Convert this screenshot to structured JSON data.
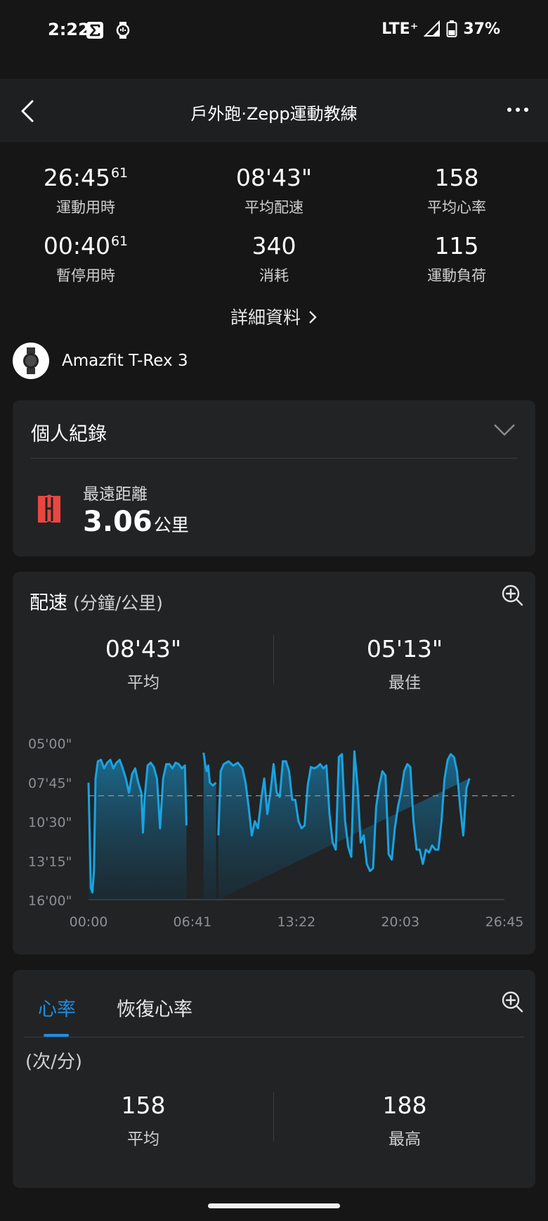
{
  "status_bar": {
    "time": "2:22",
    "network": "LTE⁺",
    "battery": "37%"
  },
  "header": {
    "title": "戶外跑·Zepp運動教練"
  },
  "summary": {
    "stats": [
      {
        "value": "26:45",
        "sup": "61",
        "label": "運動用時"
      },
      {
        "value": "08'43\"",
        "sup": "",
        "label": "平均配速"
      },
      {
        "value": "158",
        "sup": "",
        "label": "平均心率"
      },
      {
        "value": "00:40",
        "sup": "61",
        "label": "暫停用時"
      },
      {
        "value": "340",
        "sup": "",
        "label": "消耗"
      },
      {
        "value": "115",
        "sup": "",
        "label": "運動負荷"
      }
    ],
    "details_label": "詳細資料"
  },
  "device": {
    "name": "Amazfit T-Rex 3"
  },
  "personal_record": {
    "title": "個人紀錄",
    "item_label": "最遠距離",
    "item_value": "3.06",
    "item_unit": "公里"
  },
  "pace": {
    "title": "配速",
    "unit": "(分鐘/公里)",
    "avg_value": "08'43\"",
    "avg_label": "平均",
    "best_value": "05'13\"",
    "best_label": "最佳"
  },
  "chart_data": {
    "type": "area",
    "xlabel": "",
    "ylabel": "",
    "x_ticks": [
      "00:00",
      "06:41",
      "13:22",
      "20:03",
      "26:45"
    ],
    "y_ticks": [
      "05'00\"",
      "07'45\"",
      "10'30\"",
      "13'15\"",
      "16'00\""
    ],
    "ylim_minutes": [
      5,
      16
    ],
    "y_inverted": true,
    "average_line_minutes": 8.72,
    "series": [
      {
        "x_minutes": [
          0,
          0.15,
          0.25,
          0.35,
          0.45,
          0.6,
          0.8,
          1.0,
          1.2,
          1.4,
          1.6,
          1.8,
          2.0,
          2.2,
          2.4,
          2.6,
          2.8,
          3.0,
          3.2,
          3.4,
          3.5,
          3.6,
          3.8,
          4.0,
          4.2,
          4.4,
          4.6,
          4.8,
          5.0,
          5.2,
          5.4,
          5.6,
          5.8,
          6.0,
          6.2,
          6.3,
          7.4,
          7.5,
          7.6,
          7.7,
          7.8,
          8.0,
          8.2,
          8.35,
          8.5,
          8.7,
          9.0,
          9.3,
          9.6,
          9.9,
          10.1,
          10.3,
          10.5,
          10.7,
          10.9,
          11.1,
          11.3,
          11.5,
          11.7,
          11.9,
          12.1,
          12.3,
          12.5,
          12.7,
          12.9,
          13.1,
          13.3,
          13.5,
          13.7,
          13.9,
          14.1,
          14.3,
          14.5,
          14.7,
          14.9,
          15.1,
          15.3,
          15.5,
          15.7,
          15.9,
          16.1,
          16.3,
          16.5,
          16.7,
          16.9,
          17.1,
          17.3,
          17.5,
          17.7,
          17.9,
          18.1,
          18.3,
          18.5,
          18.7,
          18.9,
          19.1,
          19.3,
          19.5,
          19.7,
          19.9,
          20.1,
          20.3,
          20.5,
          20.7,
          20.9,
          21.1,
          21.3,
          21.5,
          21.7,
          21.9,
          22.1,
          22.3,
          22.5,
          22.7,
          22.9,
          23.1,
          23.3,
          23.5,
          23.7,
          23.9,
          24.1,
          24.3,
          24.5,
          24.7,
          24.9,
          25.1,
          25.3,
          25.5,
          25.7,
          25.9,
          26.1,
          26.3,
          26.5,
          26.7
        ],
        "pace_minutes": [
          7.8,
          15.2,
          15.5,
          14.0,
          7.5,
          6.3,
          6.2,
          6.8,
          6.4,
          6.2,
          6.8,
          6.4,
          6.2,
          6.8,
          7.5,
          8.5,
          7.2,
          6.8,
          7.8,
          8.5,
          11.3,
          9.0,
          6.6,
          6.4,
          6.7,
          7.5,
          11.0,
          7.5,
          6.5,
          6.5,
          6.8,
          6.4,
          6.5,
          6.8,
          6.6,
          10.8,
          5.7,
          6.5,
          7.0,
          6.6,
          7.8,
          8.0,
          7.8,
          11.5,
          7.0,
          6.5,
          6.3,
          6.6,
          6.4,
          6.8,
          7.8,
          9.5,
          11.5,
          10.5,
          11.0,
          9.0,
          7.5,
          10.0,
          8.5,
          6.5,
          8.5,
          8.8,
          6.3,
          6.3,
          7.0,
          9.0,
          9.0,
          10.5,
          11.0,
          10.8,
          8.0,
          6.7,
          6.8,
          6.7,
          6.5,
          6.8,
          6.6,
          10.0,
          12.0,
          12.5,
          6.0,
          5.8,
          10.5,
          12.3,
          13.0,
          5.6,
          8.0,
          12.0,
          11.5,
          13.5,
          14.0,
          13.8,
          9.5,
          8.0,
          7.0,
          7.3,
          12.8,
          13.2,
          11.0,
          9.5,
          8.5,
          7.0,
          6.5,
          6.7,
          10.5,
          12.5,
          12.5,
          13.5,
          12.5,
          12.7,
          12.2,
          12.5,
          12.5,
          10.5,
          7.5,
          6.2,
          5.8,
          6.0,
          7.0,
          9.5,
          11.5,
          8.2,
          7.5
        ],
        "gaps_minutes": [
          [
            6.3,
            7.4
          ],
          [
            8.2,
            8.35
          ]
        ]
      }
    ]
  },
  "heart_rate": {
    "tab_hr": "心率",
    "tab_recovery": "恢復心率",
    "unit": "(次/分)",
    "avg_value": "158",
    "avg_label": "平均",
    "max_value": "188",
    "max_label": "最高"
  },
  "colors": {
    "accent": "#1e8fe0",
    "line": "#1aa3e0",
    "pr_flag": "#e8473f"
  }
}
